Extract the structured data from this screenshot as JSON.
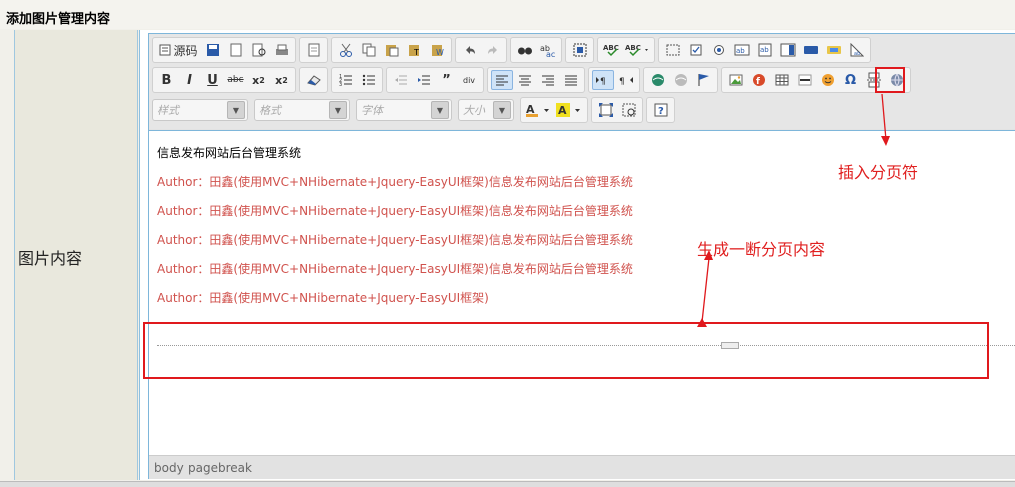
{
  "page": {
    "title": "添加图片管理内容"
  },
  "form": {
    "label": "图片内容"
  },
  "toolbar": {
    "source_label": "源码",
    "combos": [
      {
        "placeholder": "样式"
      },
      {
        "placeholder": "格式"
      },
      {
        "placeholder": "字体"
      },
      {
        "placeholder": "大小"
      }
    ]
  },
  "content": {
    "lines": [
      "信息发布网站后台管理系统",
      "Author：田鑫(使用MVC+NHibernate+Jquery-EasyUI框架)信息发布网站后台管理系统",
      "Author：田鑫(使用MVC+NHibernate+Jquery-EasyUI框架)信息发布网站后台管理系统",
      "Author：田鑫(使用MVC+NHibernate+Jquery-EasyUI框架)信息发布网站后台管理系统",
      "Author：田鑫(使用MVC+NHibernate+Jquery-EasyUI框架)信息发布网站后台管理系统",
      "Author：田鑫(使用MVC+NHibernate+Jquery-EasyUI框架)"
    ]
  },
  "statusbar": {
    "path1": "body",
    "path2": "pagebreak"
  },
  "annotations": {
    "insert_pagebreak": "插入分页符",
    "generated_page": "生成一断分页内容"
  },
  "colors": {
    "annotation_red": "#e0191d",
    "content_red": "#d0524d",
    "border_blue": "#7eb6da"
  }
}
